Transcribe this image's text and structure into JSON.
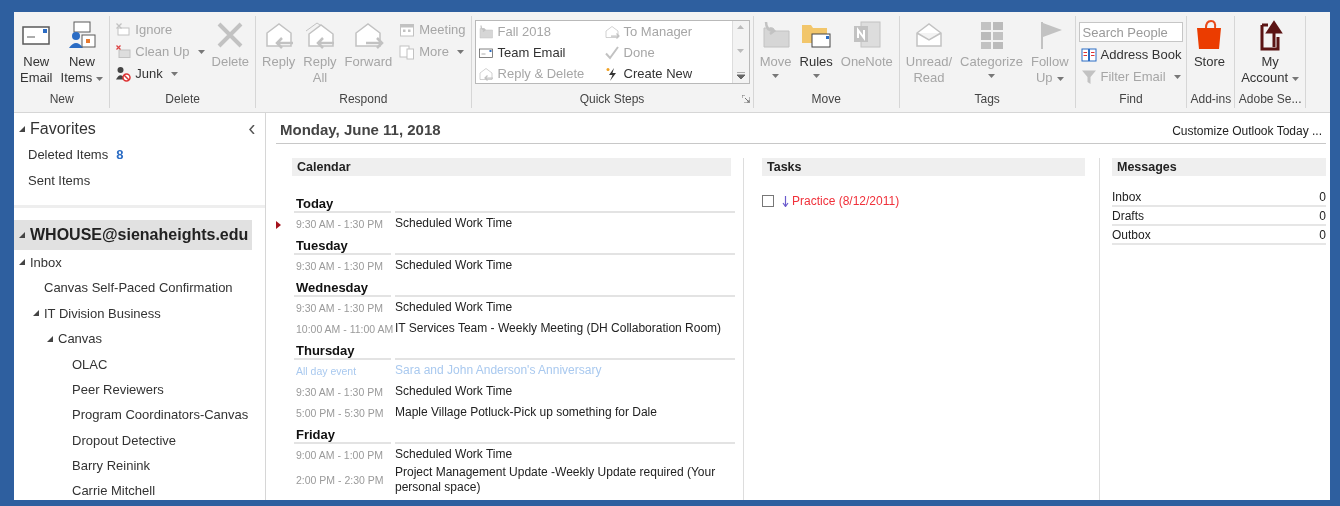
{
  "ribbon": {
    "groups": [
      {
        "label": "New",
        "launcher": false,
        "items": [
          {
            "kind": "large",
            "lines": [
              "New",
              "Email"
            ],
            "disabled": false,
            "dropdown": false
          },
          {
            "kind": "large",
            "lines": [
              "New",
              "Items"
            ],
            "disabled": false,
            "dropdown": true
          }
        ]
      },
      {
        "label": "Delete",
        "launcher": false,
        "items": [
          {
            "kind": "small",
            "lines": [
              "Ignore"
            ],
            "disabled": true,
            "dropdown": false
          },
          {
            "kind": "small",
            "lines": [
              "Clean Up"
            ],
            "disabled": true,
            "dropdown": true
          },
          {
            "kind": "small",
            "lines": [
              "Junk"
            ],
            "disabled": false,
            "dropdown": true
          },
          {
            "kind": "large",
            "lines": [
              "Delete"
            ],
            "disabled": true,
            "dropdown": false
          }
        ]
      },
      {
        "label": "Respond",
        "launcher": false,
        "items": [
          {
            "kind": "large",
            "lines": [
              "Reply"
            ],
            "disabled": true,
            "dropdown": false
          },
          {
            "kind": "large",
            "lines": [
              "Reply",
              "All"
            ],
            "disabled": true,
            "dropdown": false
          },
          {
            "kind": "large",
            "lines": [
              "Forward"
            ],
            "disabled": true,
            "dropdown": false
          },
          {
            "kind": "small",
            "lines": [
              "Meeting"
            ],
            "disabled": true,
            "dropdown": false
          },
          {
            "kind": "small",
            "lines": [
              "More"
            ],
            "disabled": true,
            "dropdown": true
          }
        ]
      },
      {
        "label": "Quick Steps",
        "launcher": true,
        "items": [
          {
            "kind": "gallery",
            "steps": [
              {
                "label": "Fall 2018",
                "disabled": true
              },
              {
                "label": "To Manager",
                "disabled": true
              },
              {
                "label": "Team Email",
                "disabled": false
              },
              {
                "label": "Done",
                "disabled": true
              },
              {
                "label": "Reply & Delete",
                "disabled": true
              },
              {
                "label": "Create New",
                "disabled": false
              }
            ]
          }
        ]
      },
      {
        "label": "Move",
        "launcher": false,
        "items": [
          {
            "kind": "large",
            "lines": [
              "Move"
            ],
            "disabled": true,
            "dropdown": true
          },
          {
            "kind": "large",
            "lines": [
              "Rules"
            ],
            "disabled": false,
            "dropdown": true
          },
          {
            "kind": "large",
            "lines": [
              "OneNote"
            ],
            "disabled": true,
            "dropdown": false
          }
        ]
      },
      {
        "label": "Tags",
        "launcher": false,
        "items": [
          {
            "kind": "large",
            "lines": [
              "Unread/",
              "Read"
            ],
            "disabled": true,
            "dropdown": false
          },
          {
            "kind": "large",
            "lines": [
              "Categorize"
            ],
            "disabled": true,
            "dropdown": true
          },
          {
            "kind": "large",
            "lines": [
              "Follow",
              "Up"
            ],
            "disabled": true,
            "dropdown": true
          }
        ]
      },
      {
        "label": "Find",
        "launcher": false,
        "items": [
          {
            "kind": "search",
            "placeholder": "Search People"
          },
          {
            "kind": "small",
            "lines": [
              "Address Book"
            ],
            "disabled": false,
            "dropdown": false
          },
          {
            "kind": "small",
            "lines": [
              "Filter Email"
            ],
            "disabled": true,
            "dropdown": true
          }
        ]
      },
      {
        "label": "Add-ins",
        "launcher": false,
        "items": [
          {
            "kind": "large",
            "lines": [
              "Store"
            ],
            "disabled": false,
            "dropdown": false
          }
        ]
      },
      {
        "label": "Adobe Se...",
        "launcher": false,
        "items": [
          {
            "kind": "large",
            "lines": [
              "My",
              "Account"
            ],
            "disabled": false,
            "dropdown": true
          }
        ]
      }
    ]
  },
  "sidebar": {
    "favorites": {
      "title": "Favorites",
      "expanded": true,
      "items": [
        {
          "label": "Deleted Items",
          "count": "8"
        },
        {
          "label": "Sent Items"
        }
      ]
    },
    "account": {
      "label": "WHOUSE@sienaheights.edu",
      "expanded": true,
      "selected": true
    },
    "folders": [
      {
        "label": "Inbox",
        "expanded": true,
        "children": [
          {
            "label": "Canvas Self-Paced Confirmation"
          },
          {
            "label": "IT Division Business",
            "expanded": true,
            "children": [
              {
                "label": "Canvas",
                "expanded": true,
                "children": [
                  {
                    "label": "OLAC"
                  },
                  {
                    "label": "Peer Reviewers"
                  },
                  {
                    "label": "Program Coordinators-Canvas"
                  },
                  {
                    "label": "Dropout Detective"
                  },
                  {
                    "label": "Barry Reinink"
                  },
                  {
                    "label": "Carrie Mitchell"
                  }
                ]
              }
            ]
          }
        ]
      }
    ]
  },
  "today": {
    "date": "Monday, June 11, 2018",
    "customize": "Customize Outlook Today ...",
    "calendar": {
      "title": "Calendar",
      "days": [
        {
          "day": "Today",
          "events": [
            {
              "time": "9:30 AM - 1:30 PM",
              "title": "Scheduled Work Time",
              "all_day": false,
              "current": true
            }
          ]
        },
        {
          "day": "Tuesday",
          "events": [
            {
              "time": "9:30 AM - 1:30 PM",
              "title": "Scheduled Work Time",
              "all_day": false,
              "current": false
            }
          ]
        },
        {
          "day": "Wednesday",
          "events": [
            {
              "time": "9:30 AM - 1:30 PM",
              "title": "Scheduled Work Time",
              "all_day": false,
              "current": false
            },
            {
              "time": "10:00 AM - 11:00 AM",
              "title": "IT Services Team - Weekly Meeting (DH Collaboration Room)",
              "all_day": false,
              "current": false
            }
          ]
        },
        {
          "day": "Thursday",
          "events": [
            {
              "time": "All day event",
              "title": "Sara and John Anderson's Anniversary",
              "all_day": true,
              "current": false
            },
            {
              "time": "9:30 AM - 1:30 PM",
              "title": "Scheduled Work Time",
              "all_day": false,
              "current": false
            },
            {
              "time": "5:00 PM - 5:30 PM",
              "title": "Maple Village Potluck-Pick up something for Dale",
              "all_day": false,
              "current": false
            }
          ]
        },
        {
          "day": "Friday",
          "events": [
            {
              "time": "9:00 AM - 1:00 PM",
              "title": "Scheduled Work Time",
              "all_day": false,
              "current": false
            },
            {
              "time": "2:00 PM - 2:30 PM",
              "title": "Project Management Update -Weekly Update required (Your personal space)",
              "all_day": false,
              "current": false
            }
          ]
        }
      ]
    },
    "tasks": {
      "title": "Tasks",
      "items": [
        {
          "title": "Practice (8/12/2011)",
          "checked": false,
          "overdue": true,
          "low_priority": true
        }
      ]
    },
    "messages": {
      "title": "Messages",
      "rows": [
        {
          "label": "Inbox",
          "count": "0"
        },
        {
          "label": "Drafts",
          "count": "0"
        },
        {
          "label": "Outbox",
          "count": "0"
        }
      ]
    }
  }
}
